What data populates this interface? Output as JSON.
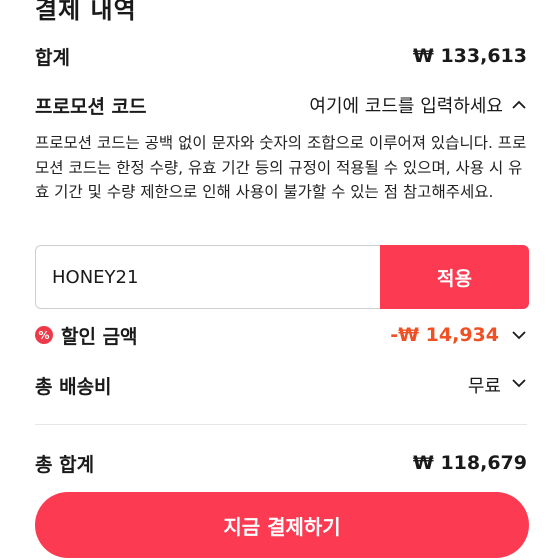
{
  "header": {
    "title": "결제 내역"
  },
  "subtotal": {
    "label": "합계",
    "value": "₩ 133,613"
  },
  "promo": {
    "label": "프로모션 코드",
    "hint": "여기에 코드를 입력하세요",
    "description": "프로모션 코드는 공백 없이 문자와 숫자의 조합으로 이루어져 있습니다. 프로모션 코드는 한정 수량, 유효 기간 등의 규정이 적용될 수 있으며, 사용 시 유효 기간 및 수량 제한으로 인해 사용이 불가할 수 있는 점 참고해주세요.",
    "input_value": "HONEY21",
    "apply_label": "적용"
  },
  "discount": {
    "icon": "percent-badge-icon",
    "label": "할인 금액",
    "value": "-₩ 14,934"
  },
  "shipping": {
    "label": "총 배송비",
    "value": "무료"
  },
  "total": {
    "label": "총 합계",
    "value": "₩ 118,679"
  },
  "pay_button": {
    "label": "지금 결제하기"
  },
  "colors": {
    "accent": "#fc3a52",
    "discount": "#f05023"
  }
}
